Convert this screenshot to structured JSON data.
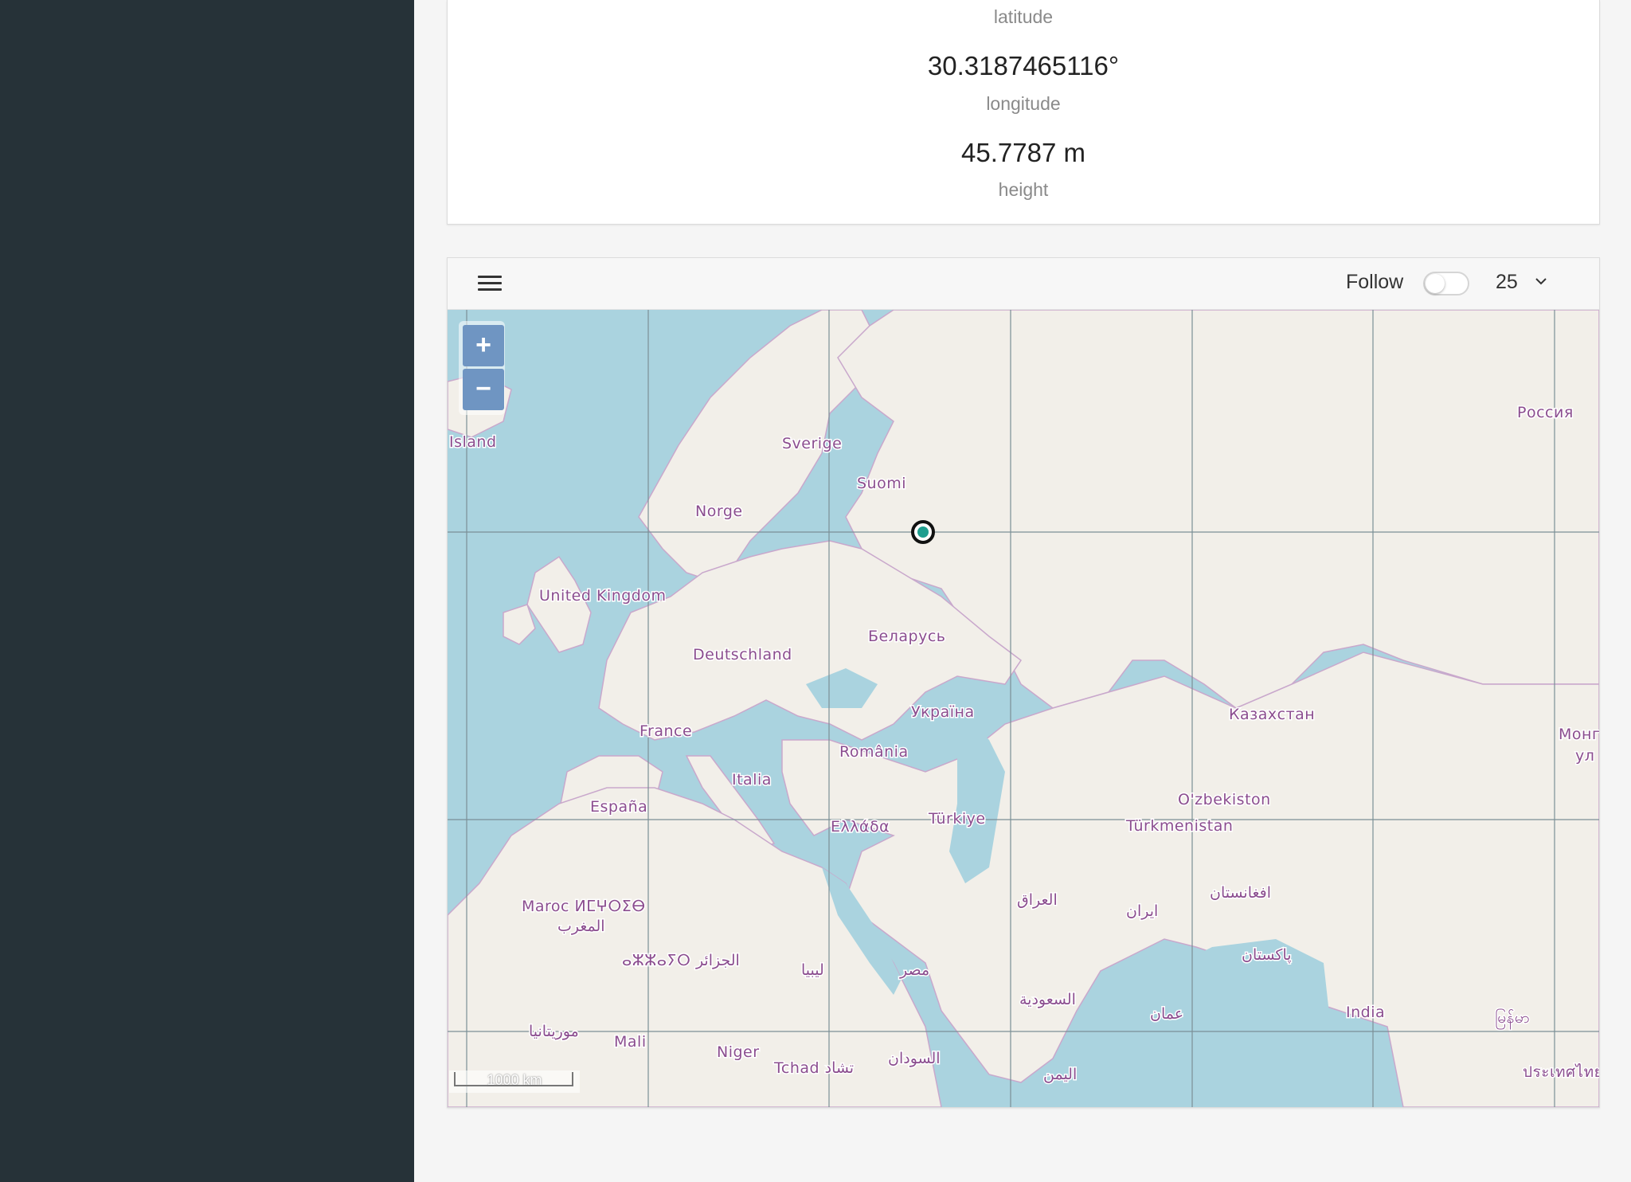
{
  "coordinates": {
    "latitude_label": "latitude",
    "longitude_value": "30.3187465116°",
    "longitude_label": "longitude",
    "height_value": "45.7787 m",
    "height_label": "height"
  },
  "map_toolbar": {
    "menu_icon": "hamburger-menu-icon",
    "follow_label": "Follow",
    "follow_enabled": false,
    "zoom_value": "25",
    "dropdown_icon": "chevron-down-icon"
  },
  "map": {
    "zoom_in": "+",
    "zoom_out": "−",
    "scale_text": "1000 km",
    "marker_icon": "position-marker-icon",
    "labels": [
      "Island",
      "Sverige",
      "Suomi",
      "Norge",
      "Россия",
      "United Kingdom",
      "Беларусь",
      "Deutschland",
      "Україна",
      "France",
      "România",
      "Казахстан",
      "Italia",
      "España",
      "Ελλάδα",
      "Türkiye",
      "O'zbekiston",
      "Türkmenistan",
      "Maroc ⵍⵎⵖⵔⵉⴱ",
      "المغرب",
      "العراق",
      "ایران",
      "افغانستان",
      "ⴰⵣⵣⴰⵢⵔ الجزائر",
      "ليبيا",
      "مصر",
      "پاکستان",
      "السعودية",
      "عمان",
      "India",
      "موريتانيا",
      "Mali",
      "Niger",
      "Tchad تشاد",
      "السودان",
      "اليمن",
      "မြန်မာ",
      "ประเทศไทย",
      "Монг",
      "ул"
    ]
  }
}
